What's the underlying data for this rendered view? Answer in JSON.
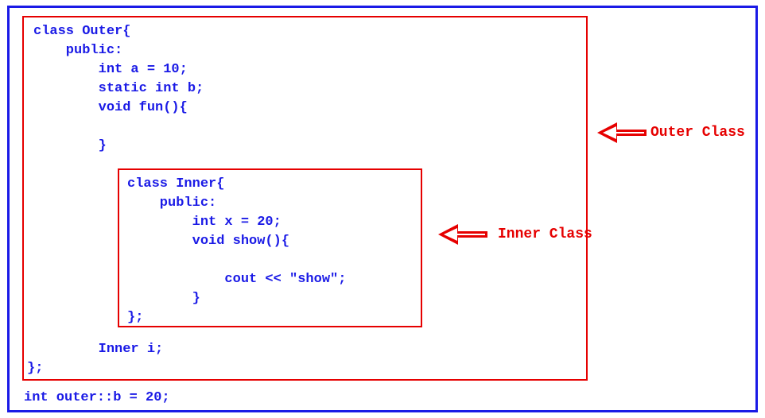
{
  "code": {
    "l1": "class Outer{",
    "l2": "    public:",
    "l3": "        int a = 10;",
    "l4": "        static int b;",
    "l5": "        void fun(){",
    "l6": "",
    "l7": "        }",
    "l8": "class Inner{",
    "l9": "    public:",
    "l10": "        int x = 20;",
    "l11": "        void show(){",
    "l12": "            cout << \"show\";",
    "l13": "        }",
    "l14": "};",
    "l15": "        Inner i;",
    "l16": "};",
    "l17": "int outer::b = 20;"
  },
  "labels": {
    "outer": "Outer Class",
    "inner": "Inner Class"
  }
}
